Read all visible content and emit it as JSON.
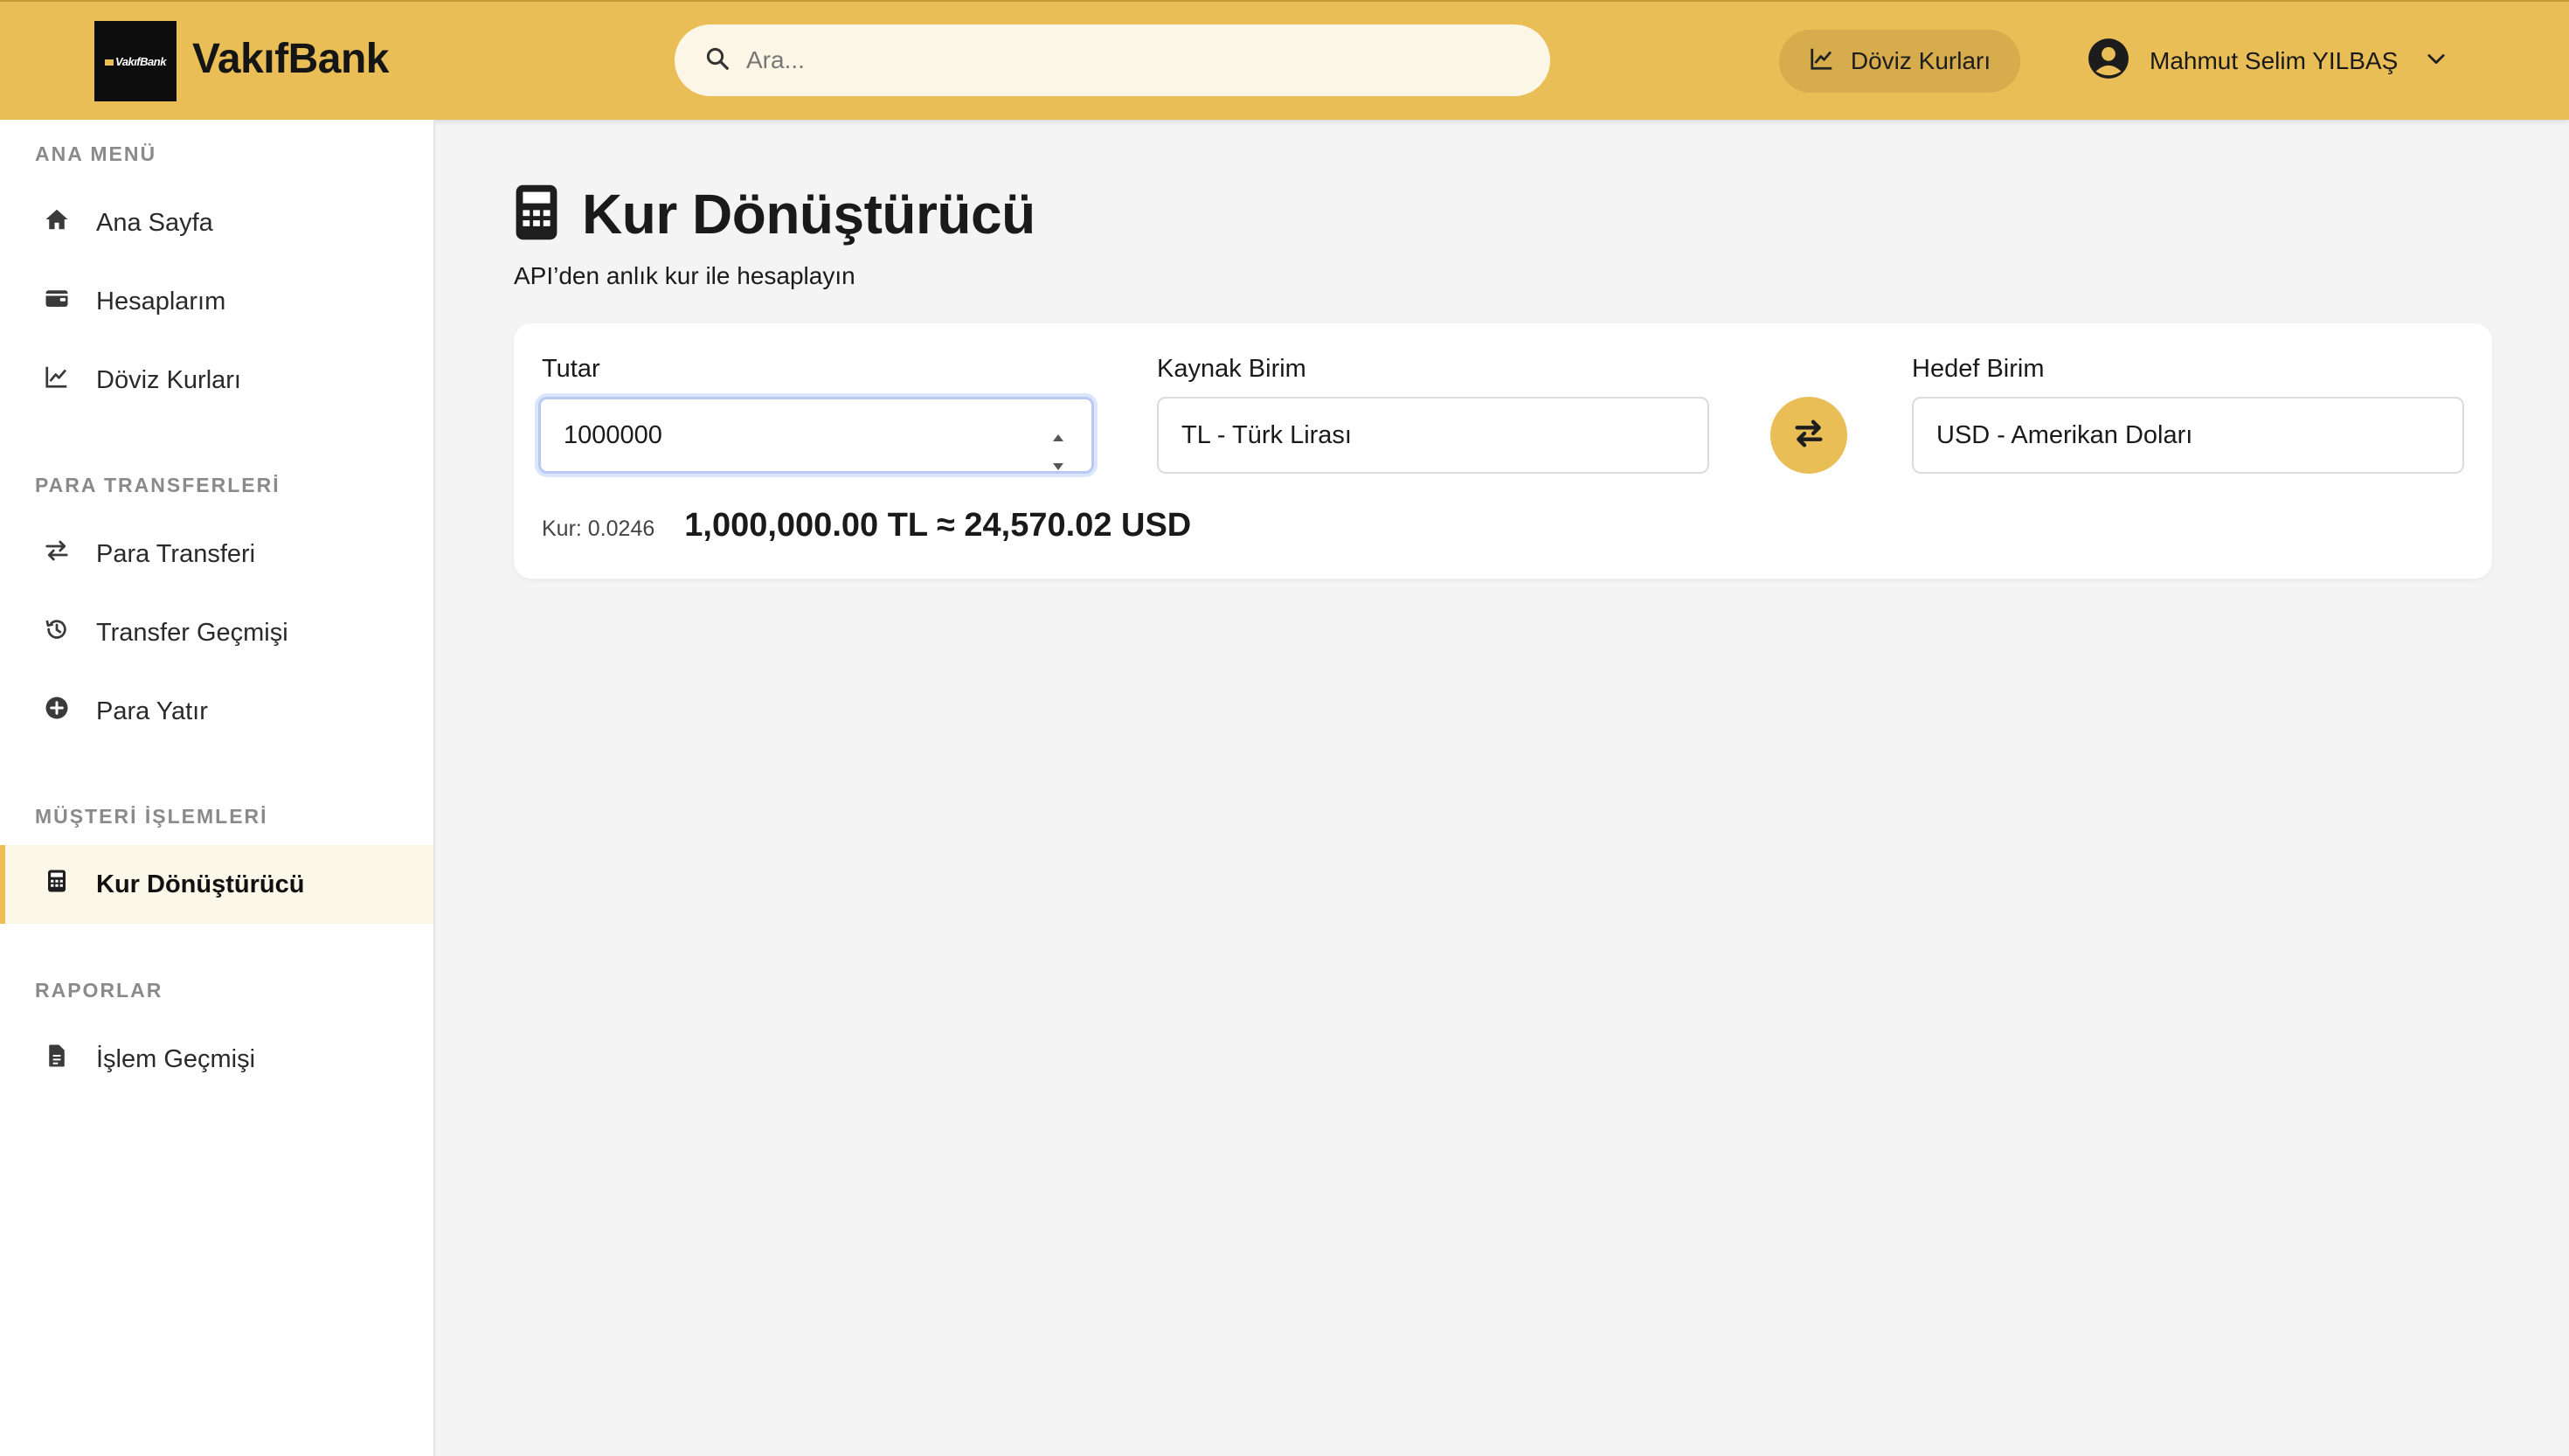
{
  "header": {
    "logo_text": "VakıfBank",
    "brand": "VakıfBank",
    "search_placeholder": "Ara...",
    "fx_button": "Döviz Kurları",
    "user_name": "Mahmut Selim YILBAŞ"
  },
  "sidebar": {
    "sections": [
      {
        "title": "ANA MENÜ",
        "items": [
          {
            "label": "Ana Sayfa",
            "icon": "home-icon"
          },
          {
            "label": "Hesaplarım",
            "icon": "wallet-icon"
          },
          {
            "label": "Döviz Kurları",
            "icon": "chart-line-icon"
          }
        ]
      },
      {
        "title": "PARA TRANSFERLERİ",
        "items": [
          {
            "label": "Para Transferi",
            "icon": "transfer-icon"
          },
          {
            "label": "Transfer Geçmişi",
            "icon": "history-icon"
          },
          {
            "label": "Para Yatır",
            "icon": "plus-circle-icon"
          }
        ]
      },
      {
        "title": "MÜŞTERİ İŞLEMLERİ",
        "items": [
          {
            "label": "Kur Dönüştürücü",
            "icon": "calculator-icon",
            "active": true
          }
        ]
      },
      {
        "title": "RAPORLAR",
        "items": [
          {
            "label": "İşlem Geçmişi",
            "icon": "document-icon"
          }
        ]
      }
    ]
  },
  "main": {
    "title": "Kur Dönüştürücü",
    "subtitle": "API’den anlık kur ile hesaplayın",
    "amount_label": "Tutar",
    "amount_value": "1000000",
    "source_label": "Kaynak Birim",
    "source_value": "TL - Türk Lirası",
    "target_label": "Hedef Birim",
    "target_value": "USD - Amerikan Doları",
    "rate_text": "Kur: 0.0246",
    "result_text": "1,000,000.00 TL ≈ 24,570.02 USD"
  },
  "colors": {
    "accent": "#e9be57",
    "accent_dark": "#d6ac4c",
    "background": "#f4f4f4"
  }
}
